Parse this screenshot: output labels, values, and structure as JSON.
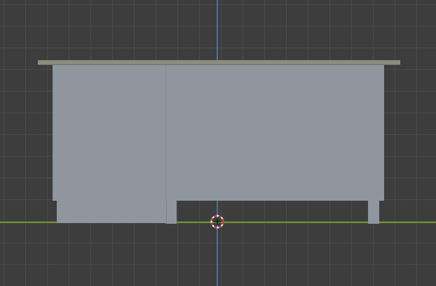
{
  "viewport": {
    "name": "3d-viewport",
    "axes": {
      "x_color": "#6f9a2d",
      "y_color": "#3f6fb8"
    },
    "grid": {
      "visible": true,
      "line_color": "#4a4a4a",
      "background_color": "#3d3d3d"
    },
    "object": {
      "countertop_color": "#8c8c7d",
      "body_color": "#8f969d",
      "edge_color": "#7f868d"
    },
    "cursor": {
      "icon": "3d-cursor-icon",
      "ring_color": "#c0392b",
      "accent_color": "#ffffff"
    }
  }
}
